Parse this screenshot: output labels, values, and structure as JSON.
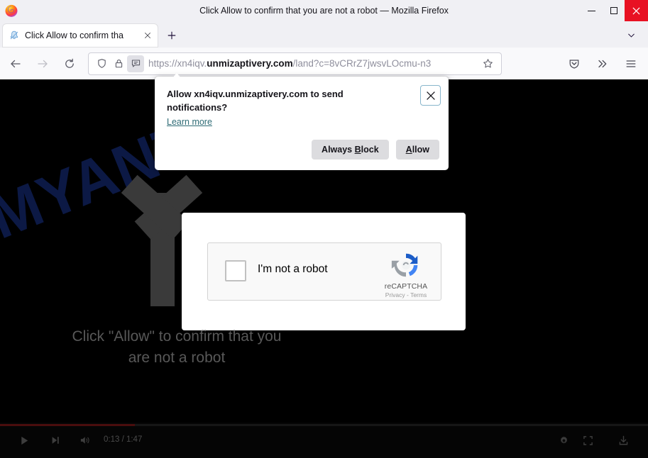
{
  "window": {
    "title": "Click Allow to confirm that you are not a robot — Mozilla Firefox",
    "app_icon": "firefox-logo-icon",
    "controls": {
      "minimize": "minimize-icon",
      "maximize": "maximize-icon",
      "close": "close-icon"
    }
  },
  "tabs": {
    "items": [
      {
        "title": "Click Allow to confirm tha",
        "favicon": "bell-notification-icon",
        "close": "close-tab-icon"
      }
    ],
    "new_tab_label": "+",
    "list_all_tabs": "chevron-down-icon"
  },
  "toolbar": {
    "back": "back-arrow-icon",
    "forward": "forward-arrow-icon",
    "reload": "reload-icon",
    "shield": "shield-icon",
    "lock": "padlock-icon",
    "permission": "notification-permission-icon",
    "url_prefix": "https://xn4iqv.",
    "url_domain": "unmizaptivery.com",
    "url_path": "/land?c=8vCRrZ7jwsvLOcmu-n3",
    "bookmark": "star-icon",
    "pocket": "pocket-save-icon",
    "overflow": "double-chevron-right-icon",
    "menu": "hamburger-menu-icon"
  },
  "notification": {
    "title": "Allow xn4iqv.unmizaptivery.com to send notifications?",
    "learn_more": "Learn more",
    "close_icon": "close-icon",
    "buttons": {
      "always_block": "Always Block",
      "always_block_accesskey": "B",
      "allow": "Allow",
      "allow_accesskey": "A"
    }
  },
  "page": {
    "background_color": "#000000",
    "watermark": "MYANTISPYWARE.COM",
    "watermark_color": "#0d1b49",
    "arrow": "up-arrow-pointer-icon",
    "message_line1": "Click \"Allow\" to confirm that you",
    "message_line2": "are not a robot",
    "recaptcha": {
      "checkbox_label": "I'm not a robot",
      "brand_name": "reCAPTCHA",
      "terms": "Privacy - Terms",
      "logo": "recaptcha-logo-icon",
      "checked": false
    }
  },
  "video": {
    "play": "play-icon",
    "next": "next-track-icon",
    "volume": "volume-on-icon",
    "time_current": "0:13",
    "time_separator": "/",
    "time_total": "1:47",
    "time_display": "0:13 / 1:47",
    "settings": "gear-icon",
    "fullscreen": "fullscreen-icon",
    "download": "download-icon",
    "progress_color": "#4a0d0d"
  }
}
